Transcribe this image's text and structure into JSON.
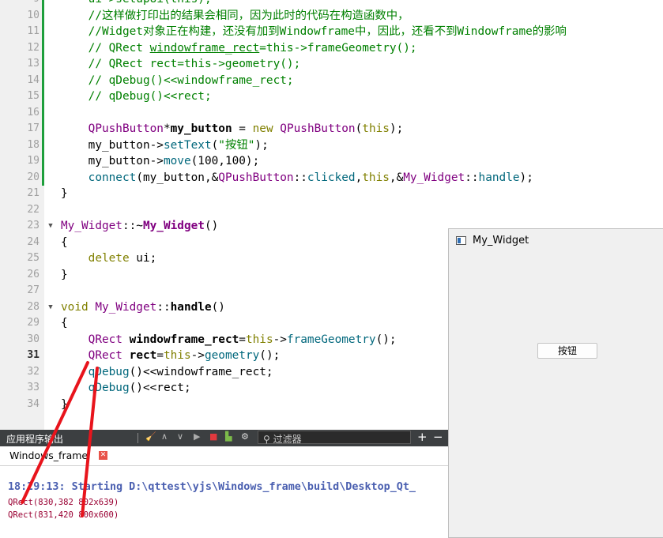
{
  "editor": {
    "lines": [
      {
        "n": "9",
        "segs": [
          {
            "t": "    ui->setupUi(this);",
            "c": "cm0"
          }
        ],
        "mark": true
      },
      {
        "n": "10",
        "segs": [
          {
            "t": "    //这样做打印出的结果会相同，因为此时的代码在构造函数中，",
            "c": "cm"
          }
        ],
        "mark": true
      },
      {
        "n": "11",
        "segs": [
          {
            "t": "    //Widget对象正在构建，还没有加到Windowframe中，因此，还看不到Windowframe的影响",
            "c": "cm"
          }
        ],
        "mark": true
      },
      {
        "n": "12",
        "segs": [
          {
            "t": "    // QRect ",
            "c": "cm"
          },
          {
            "t": "windowframe_rect",
            "c": "cm ul"
          },
          {
            "t": "=this->frameGeometry();",
            "c": "cm"
          }
        ],
        "mark": true
      },
      {
        "n": "13",
        "segs": [
          {
            "t": "    // QRect rect=this->geometry();",
            "c": "cm"
          }
        ],
        "mark": true
      },
      {
        "n": "14",
        "segs": [
          {
            "t": "    // qDebug()<<windowframe_rect;",
            "c": "cm"
          }
        ],
        "mark": true
      },
      {
        "n": "15",
        "segs": [
          {
            "t": "    // qDebug()<<rect;",
            "c": "cm"
          }
        ],
        "mark": true
      },
      {
        "n": "16",
        "segs": [
          {
            "t": "",
            "c": ""
          }
        ],
        "mark": true
      },
      {
        "n": "17",
        "segs": [
          {
            "t": "    ",
            "c": ""
          },
          {
            "t": "QPushButton",
            "c": "ty"
          },
          {
            "t": "*",
            "c": ""
          },
          {
            "t": "my_button",
            "c": "bld"
          },
          {
            "t": " = ",
            "c": ""
          },
          {
            "t": "new",
            "c": "kw"
          },
          {
            "t": " ",
            "c": ""
          },
          {
            "t": "QPushButton",
            "c": "ty"
          },
          {
            "t": "(",
            "c": ""
          },
          {
            "t": "this",
            "c": "kw"
          },
          {
            "t": ");",
            "c": ""
          }
        ],
        "mark": true
      },
      {
        "n": "18",
        "segs": [
          {
            "t": "    my_button->",
            "c": ""
          },
          {
            "t": "setText",
            "c": "fn"
          },
          {
            "t": "(",
            "c": ""
          },
          {
            "t": "\"按钮\"",
            "c": "st"
          },
          {
            "t": ");",
            "c": ""
          }
        ],
        "mark": true
      },
      {
        "n": "19",
        "segs": [
          {
            "t": "    my_button->",
            "c": ""
          },
          {
            "t": "move",
            "c": "fn"
          },
          {
            "t": "(100,100);",
            "c": ""
          }
        ],
        "mark": true
      },
      {
        "n": "20",
        "segs": [
          {
            "t": "    ",
            "c": ""
          },
          {
            "t": "connect",
            "c": "fn"
          },
          {
            "t": "(my_button,&",
            "c": ""
          },
          {
            "t": "QPushButton",
            "c": "ty"
          },
          {
            "t": "::",
            "c": ""
          },
          {
            "t": "clicked",
            "c": "fn"
          },
          {
            "t": ",",
            "c": ""
          },
          {
            "t": "this",
            "c": "kw"
          },
          {
            "t": ",&",
            "c": ""
          },
          {
            "t": "My_Widget",
            "c": "ty"
          },
          {
            "t": "::",
            "c": ""
          },
          {
            "t": "handle",
            "c": "fn"
          },
          {
            "t": ");",
            "c": ""
          }
        ],
        "mark": true
      },
      {
        "n": "21",
        "segs": [
          {
            "t": "}",
            "c": ""
          }
        ],
        "mark": false
      },
      {
        "n": "22",
        "segs": [
          {
            "t": "",
            "c": ""
          }
        ],
        "mark": false
      },
      {
        "n": "23",
        "fold": "▼",
        "segs": [
          {
            "t": "My_Widget",
            "c": "ty"
          },
          {
            "t": "::~",
            "c": ""
          },
          {
            "t": "My_Widget",
            "c": "ty bd"
          },
          {
            "t": "()",
            "c": ""
          }
        ],
        "mark": false
      },
      {
        "n": "24",
        "segs": [
          {
            "t": "{",
            "c": ""
          }
        ],
        "mark": false
      },
      {
        "n": "25",
        "segs": [
          {
            "t": "    ",
            "c": ""
          },
          {
            "t": "delete",
            "c": "kw"
          },
          {
            "t": " ui;",
            "c": ""
          }
        ],
        "mark": false
      },
      {
        "n": "26",
        "segs": [
          {
            "t": "}",
            "c": ""
          }
        ],
        "mark": false
      },
      {
        "n": "27",
        "segs": [
          {
            "t": "",
            "c": ""
          }
        ],
        "mark": false
      },
      {
        "n": "28",
        "fold": "▼",
        "segs": [
          {
            "t": "void",
            "c": "kw"
          },
          {
            "t": " ",
            "c": ""
          },
          {
            "t": "My_Widget",
            "c": "ty"
          },
          {
            "t": "::",
            "c": ""
          },
          {
            "t": "handle",
            "c": "bd"
          },
          {
            "t": "()",
            "c": ""
          }
        ],
        "mark": false
      },
      {
        "n": "29",
        "segs": [
          {
            "t": "{",
            "c": ""
          }
        ],
        "mark": false
      },
      {
        "n": "30",
        "segs": [
          {
            "t": "    ",
            "c": ""
          },
          {
            "t": "QRect",
            "c": "ty"
          },
          {
            "t": " ",
            "c": ""
          },
          {
            "t": "windowframe_rect",
            "c": "bld"
          },
          {
            "t": "=",
            "c": ""
          },
          {
            "t": "this",
            "c": "kw"
          },
          {
            "t": "->",
            "c": ""
          },
          {
            "t": "frameGeometry",
            "c": "fn"
          },
          {
            "t": "();",
            "c": ""
          }
        ],
        "mark": false
      },
      {
        "n": "31",
        "cur": true,
        "segs": [
          {
            "t": "    ",
            "c": ""
          },
          {
            "t": "QRect",
            "c": "ty"
          },
          {
            "t": " ",
            "c": ""
          },
          {
            "t": "rect",
            "c": "bld"
          },
          {
            "t": "=",
            "c": ""
          },
          {
            "t": "this",
            "c": "kw"
          },
          {
            "t": "->",
            "c": ""
          },
          {
            "t": "geometry",
            "c": "fn"
          },
          {
            "t": "();",
            "c": ""
          }
        ],
        "mark": false
      },
      {
        "n": "32",
        "segs": [
          {
            "t": "    ",
            "c": ""
          },
          {
            "t": "qDebug",
            "c": "fn"
          },
          {
            "t": "()<<windowframe_rect;",
            "c": ""
          }
        ],
        "mark": false
      },
      {
        "n": "33",
        "segs": [
          {
            "t": "    ",
            "c": ""
          },
          {
            "t": "qDebug",
            "c": "fn"
          },
          {
            "t": "()<<rect;",
            "c": ""
          }
        ],
        "mark": false
      },
      {
        "n": "34",
        "segs": [
          {
            "t": "}",
            "c": ""
          }
        ],
        "mark": false
      }
    ]
  },
  "window": {
    "title": "My_Widget",
    "button_label": "按钮"
  },
  "output": {
    "pane_title": "应用程序输出",
    "filter_placeholder": "过滤器",
    "plus_label": "+",
    "minus_label": "−",
    "tab_label": "Windows_frame",
    "tab_close": "✕",
    "start_line": "18:29:13: Starting D:\\qttest\\yjs\\Windows_frame\\build\\Desktop_Qt_",
    "rect_lines": [
      "QRect(830,382 802x639)",
      "QRect(831,420 800x600)"
    ]
  },
  "colors": {
    "change_marker": "#1e9f3c",
    "annotation": "#e8141c",
    "output_start": "#4a5fb0",
    "output_rect": "#9a0033"
  }
}
